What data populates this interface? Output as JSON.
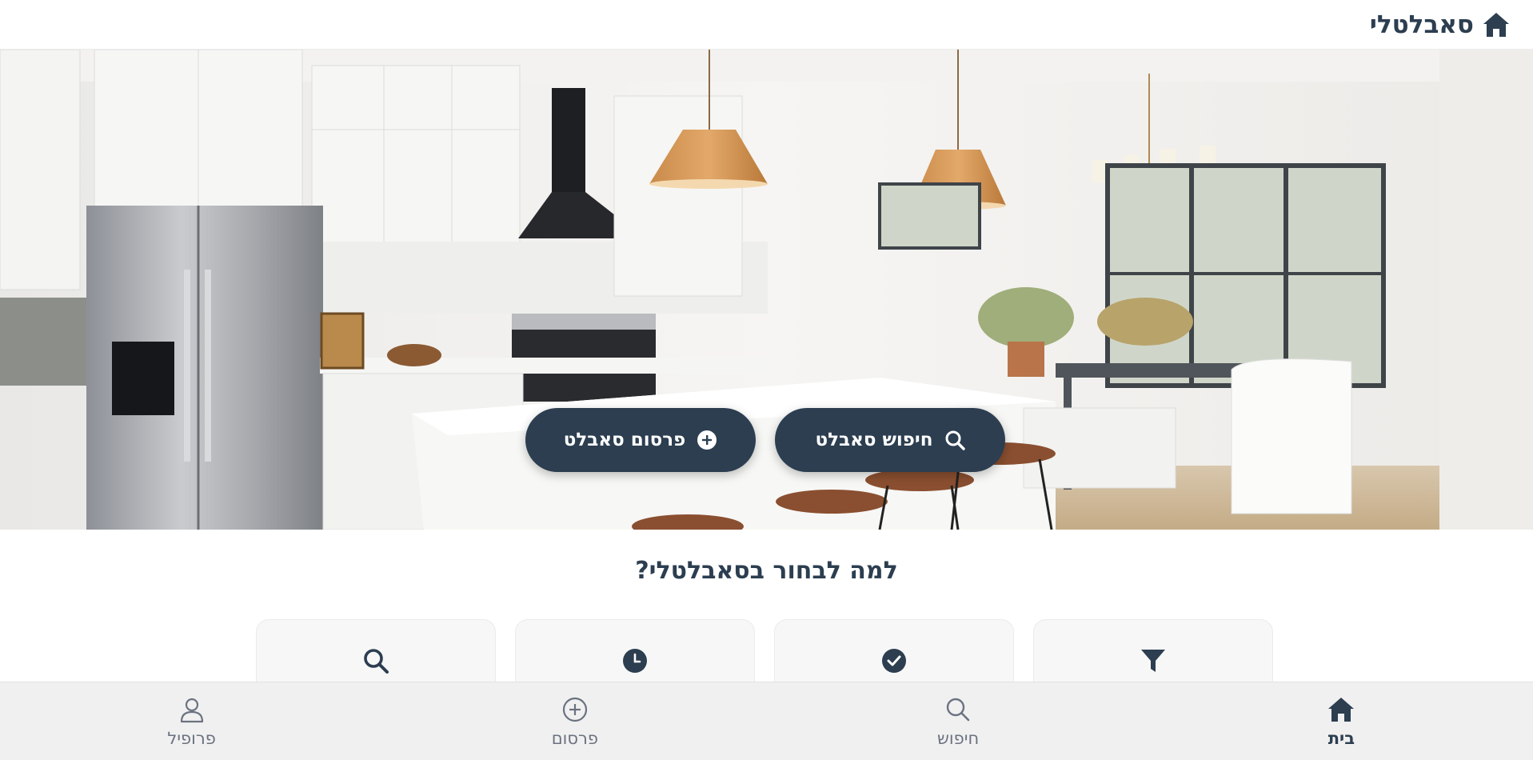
{
  "header": {
    "app_title": "סאבלטלי",
    "logo_icon": "home-icon"
  },
  "hero": {
    "image": "kitchen-interior-photo",
    "buttons": [
      {
        "label": "חיפוש סאבלט",
        "icon": "search-icon"
      },
      {
        "label": "פרסום סאבלט",
        "icon": "plus-circle-icon"
      }
    ]
  },
  "why": {
    "title": "למה לבחור בסאבלטלי?",
    "cards": [
      {
        "icon": "filter-icon"
      },
      {
        "icon": "check-circle-icon"
      },
      {
        "icon": "clock-icon"
      },
      {
        "icon": "search-icon"
      }
    ]
  },
  "bottom_nav": {
    "items": [
      {
        "label": "בית",
        "icon": "home-icon",
        "active": true
      },
      {
        "label": "חיפוש",
        "icon": "search-icon",
        "active": false
      },
      {
        "label": "פרסום",
        "icon": "plus-circle-icon",
        "active": false
      },
      {
        "label": "פרופיל",
        "icon": "user-icon",
        "active": false
      }
    ]
  },
  "colors": {
    "primary": "#2c3e50",
    "nav_bg": "#f0f0f0",
    "card_bg": "#f7f7f7",
    "muted": "#6b7280"
  }
}
